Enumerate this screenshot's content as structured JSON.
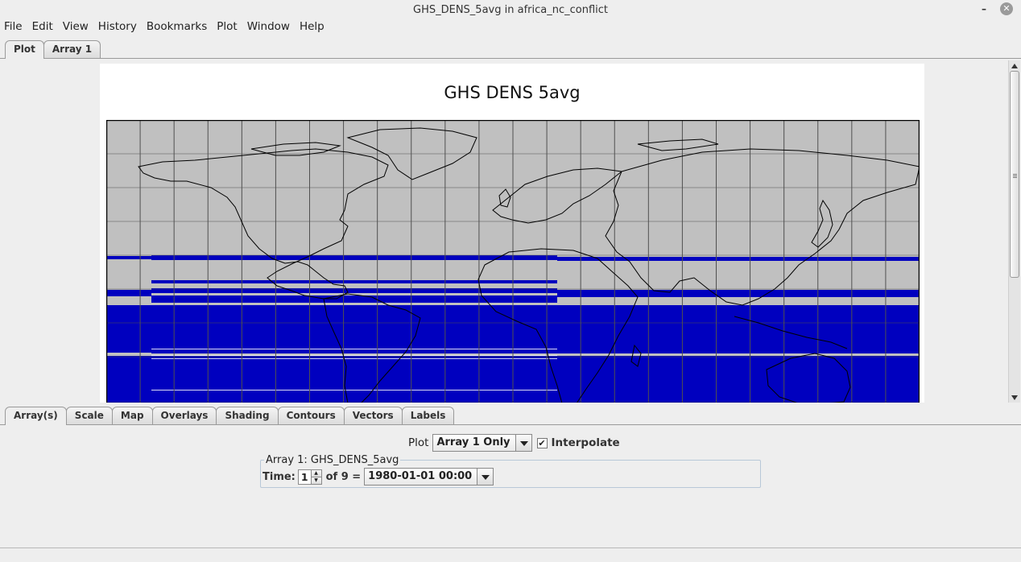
{
  "window": {
    "title": "GHS_DENS_5avg in africa_nc_conflict",
    "minimize_glyph": "–",
    "close_glyph": "✕"
  },
  "menu": [
    "File",
    "Edit",
    "View",
    "History",
    "Bookmarks",
    "Plot",
    "Window",
    "Help"
  ],
  "top_tabs": [
    {
      "label": "Plot",
      "active": true
    },
    {
      "label": "Array 1",
      "active": false
    }
  ],
  "plot": {
    "title": "GHS DENS 5avg",
    "colors": {
      "land_no_data": "#c0c0c0",
      "data_fill": "#0000bf",
      "grid": "#555555",
      "coast": "#000000"
    }
  },
  "bottom_tabs": [
    {
      "label": "Array(s)",
      "active": true
    },
    {
      "label": "Scale",
      "active": false
    },
    {
      "label": "Map",
      "active": false
    },
    {
      "label": "Overlays",
      "active": false
    },
    {
      "label": "Shading",
      "active": false
    },
    {
      "label": "Contours",
      "active": false
    },
    {
      "label": "Vectors",
      "active": false
    },
    {
      "label": "Labels",
      "active": false
    }
  ],
  "controls": {
    "plot_label": "Plot",
    "plot_mode": "Array 1 Only",
    "interpolate_label": "Interpolate",
    "interpolate_checked": true,
    "check_glyph": "✔",
    "array_group_title": "Array 1: GHS_DENS_5avg",
    "time_label": "Time:",
    "time_index": "1",
    "of_text": "of 9 =",
    "time_value": "1980-01-01 00:00",
    "spin_up": "▲",
    "spin_down": "▼"
  }
}
